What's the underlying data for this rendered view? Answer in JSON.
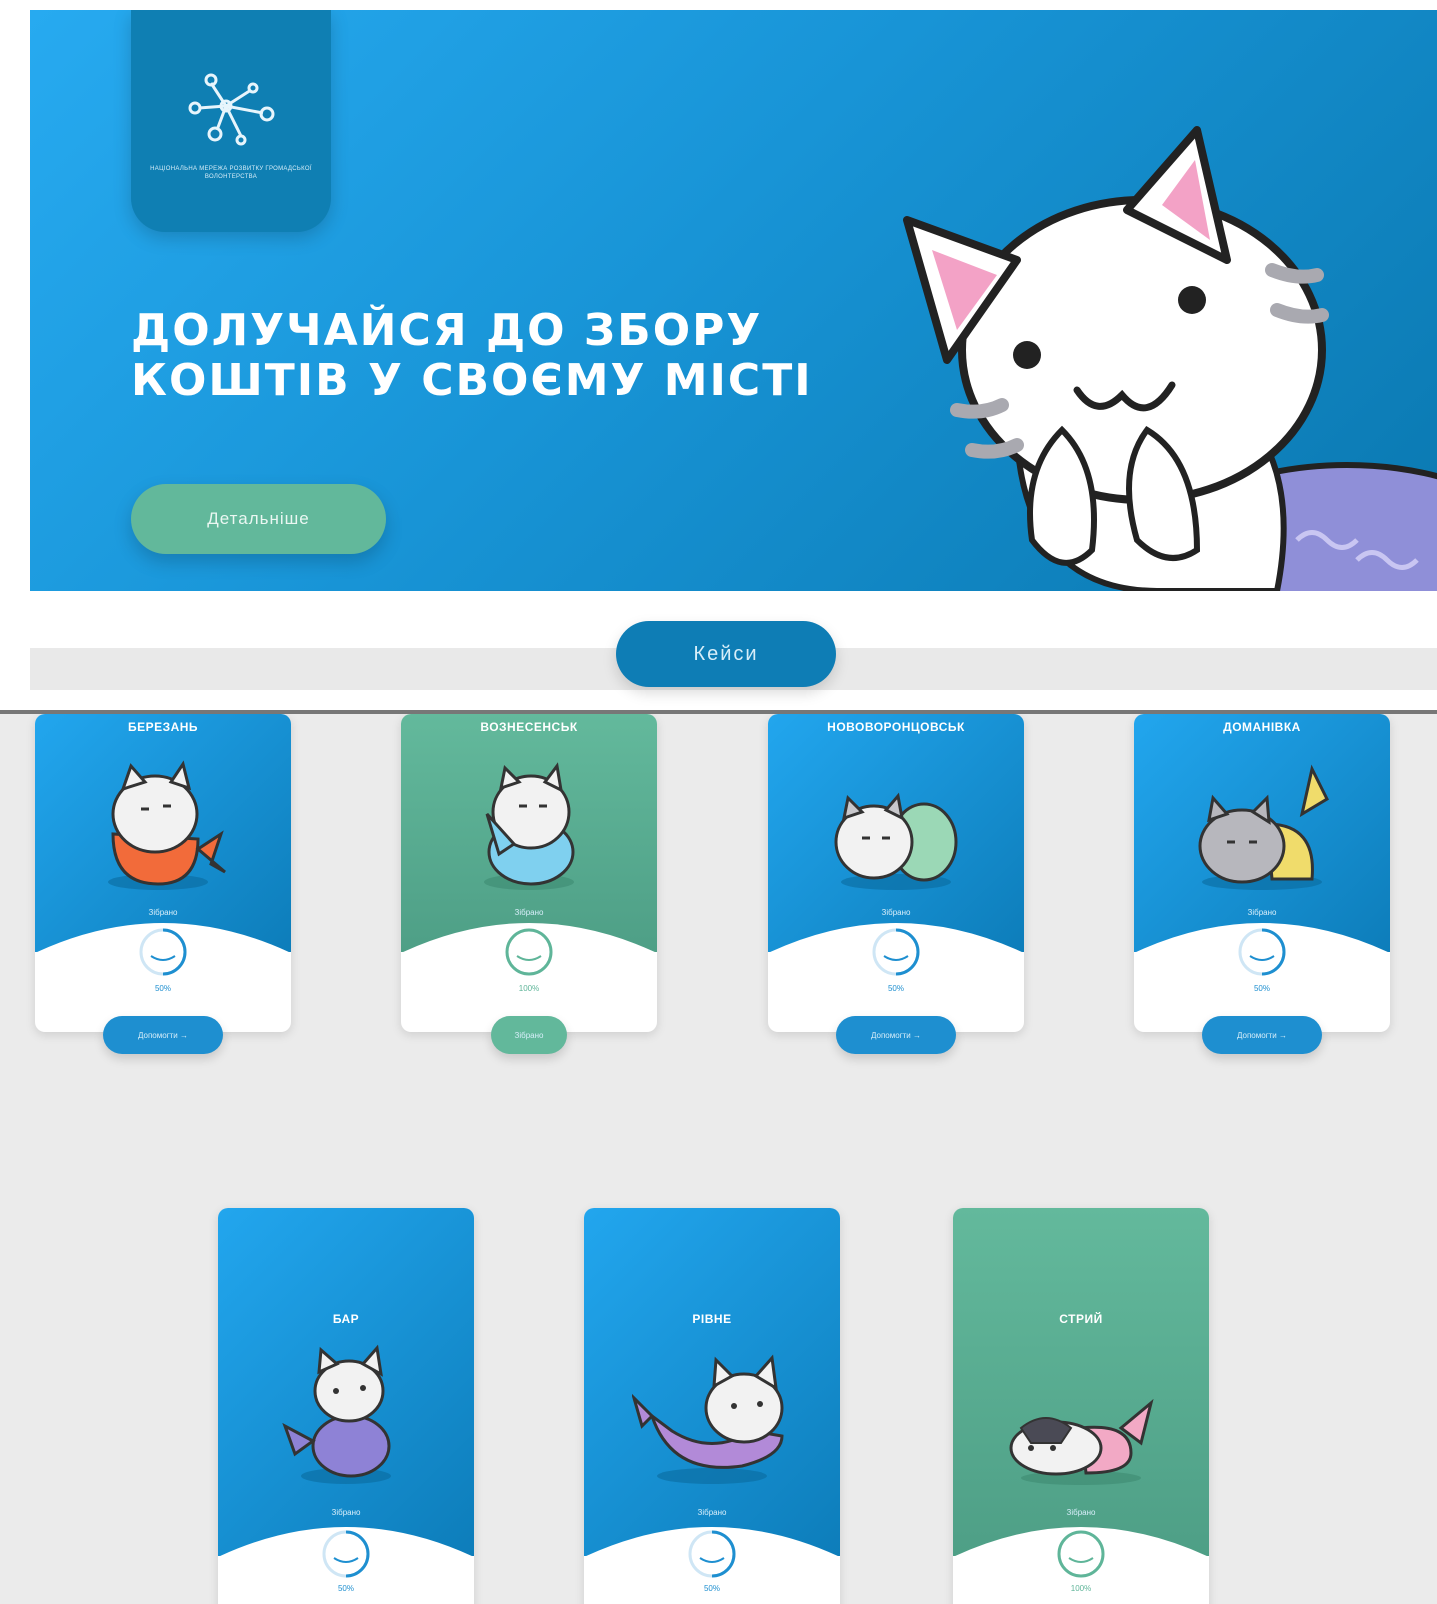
{
  "hero": {
    "logo_text": "НАЦІОНАЛЬНА МЕРЕЖА РОЗВИТКУ ГРОМАДСЬКОЇ ВОЛОНТЕРСТВА",
    "title_line1": "ДОЛУЧАЙСЯ ДО ЗБОРУ",
    "title_line2": "КОШТІВ У СВОЄМУ МІСТІ",
    "details_button": "Детальніше"
  },
  "section": {
    "cases_button": "Кейси"
  },
  "cards": [
    {
      "city": "БЕРЕЗАНЬ",
      "collected_label": "Зібрано",
      "percent": "50%",
      "button": "Допомогти →",
      "theme": "blue",
      "tail_color": "#f26b3a"
    },
    {
      "city": "ВОЗНЕСЕНСЬК",
      "collected_label": "Зібрано",
      "percent": "100%",
      "button": "Зібрано",
      "theme": "green",
      "tail_color": "#7fd0ef"
    },
    {
      "city": "НОВОВОРОНЦОВСЬК",
      "collected_label": "Зібрано",
      "percent": "50%",
      "button": "Допомогти →",
      "theme": "blue",
      "tail_color": "#9bd8b6"
    },
    {
      "city": "ДОМАНІВКА",
      "collected_label": "Зібрано",
      "percent": "50%",
      "button": "Допомогти →",
      "theme": "blue",
      "tail_color": "#f0dc6b"
    },
    {
      "city": "БАР",
      "collected_label": "Зібрано",
      "percent": "50%",
      "theme": "blue",
      "tail_color": "#8e82d6"
    },
    {
      "city": "РІВНЕ",
      "collected_label": "Зібрано",
      "percent": "50%",
      "theme": "blue",
      "tail_color": "#b28ad8"
    },
    {
      "city": "СТРИЙ",
      "collected_label": "Зібрано",
      "percent": "100%",
      "theme": "green",
      "tail_color": "#f2a9c5"
    }
  ],
  "colors": {
    "brand_blue": "#1e8fd0",
    "brand_green": "#62b89b",
    "background_gray": "#ebebeb"
  },
  "icons": [
    "network-logo-icon",
    "mermaid-cat-mascot",
    "progress-ring-icon"
  ]
}
